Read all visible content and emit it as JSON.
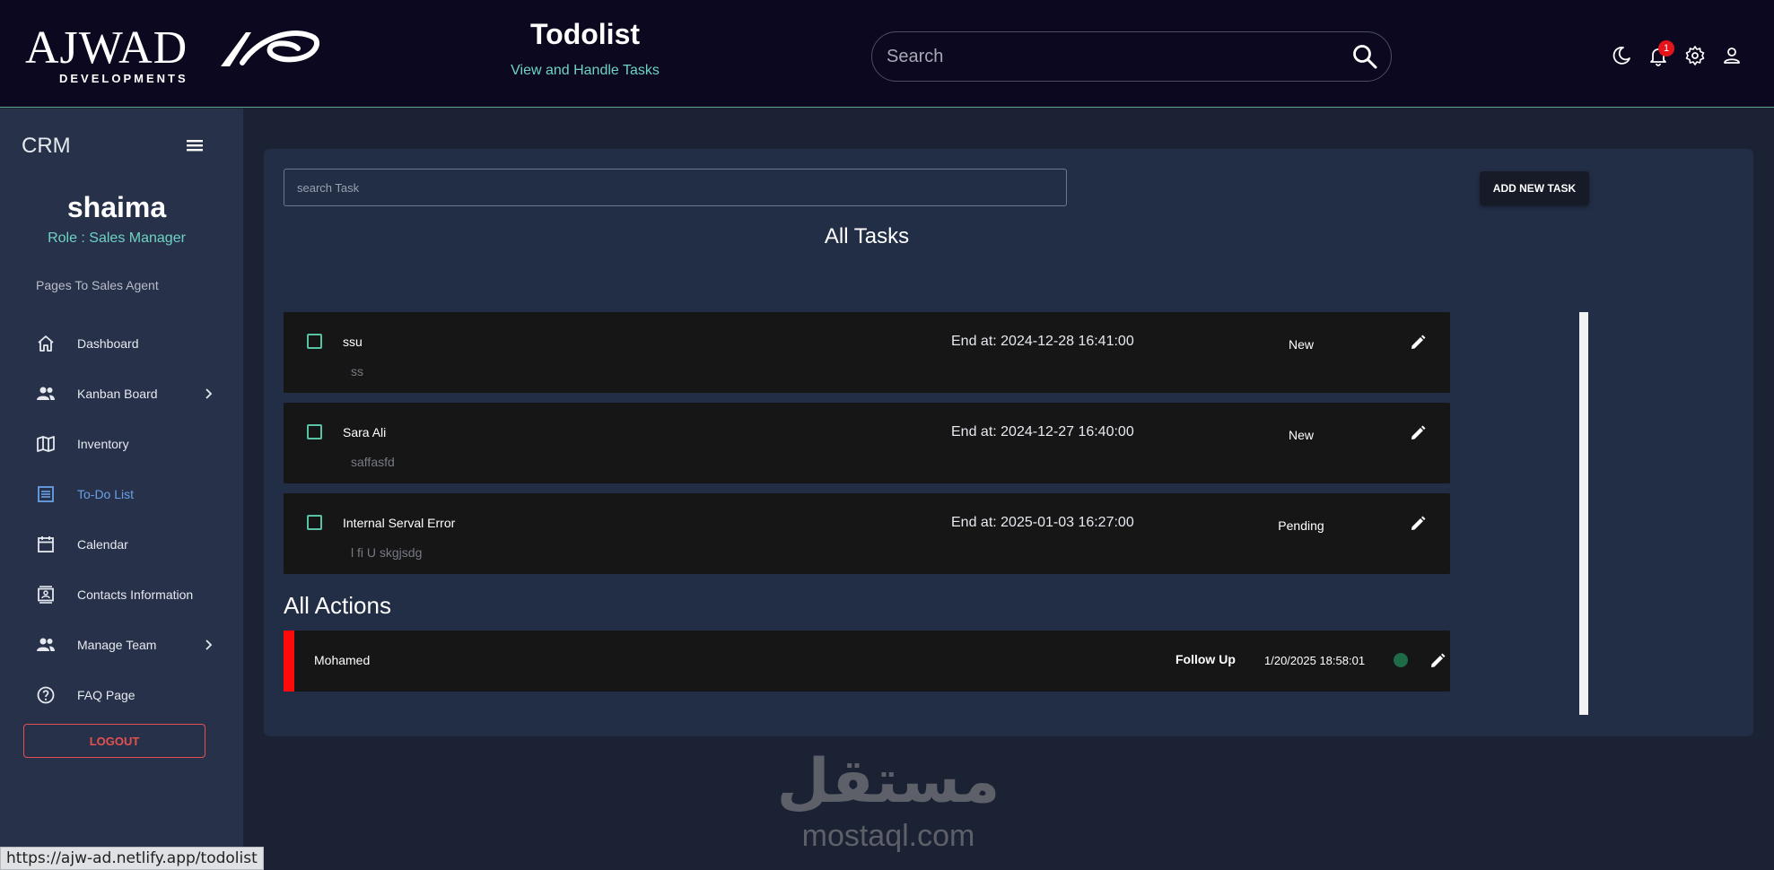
{
  "header": {
    "logo_main": "AJWAD",
    "logo_sub": "DEVELOPMENTS",
    "title": "Todolist",
    "subtitle": "View and Handle Tasks",
    "search_placeholder": "Search",
    "notification_count": "1",
    "icons": [
      "moon-icon",
      "bell-icon",
      "gear-icon",
      "user-icon"
    ]
  },
  "sidebar": {
    "brand": "CRM",
    "user_name": "shaima",
    "user_role": "Role : Sales Manager",
    "section_label": "Pages To Sales Agent",
    "items": [
      {
        "label": "Dashboard",
        "icon": "home-icon"
      },
      {
        "label": "Kanban Board",
        "icon": "people-icon",
        "has_submenu": true
      },
      {
        "label": "Inventory",
        "icon": "map-icon"
      },
      {
        "label": "To-Do List",
        "icon": "list-icon",
        "active": true
      },
      {
        "label": "Calendar",
        "icon": "calendar-icon"
      },
      {
        "label": "Contacts Information",
        "icon": "contacts-icon"
      },
      {
        "label": "Manage Team",
        "icon": "people-icon",
        "has_submenu": true
      },
      {
        "label": "FAQ Page",
        "icon": "help-icon"
      }
    ],
    "logout_label": "LOGOUT"
  },
  "main": {
    "search_placeholder": "search Task",
    "add_task_label": "ADD NEW TASK",
    "tasks_heading": "All Tasks",
    "tasks": [
      {
        "title": "ssu",
        "description": "ss",
        "end_at": "End at: 2024-12-28  16:41:00",
        "status": "New"
      },
      {
        "title": "Sara Ali",
        "description": "saffasfd",
        "end_at": "End at: 2024-12-27  16:40:00",
        "status": "New"
      },
      {
        "title": "Internal Serval Error",
        "description": "l fi U skgjsdg",
        "end_at": "End at: 2025-01-03  16:27:00",
        "status": "Pending"
      }
    ],
    "actions_heading": "All Actions",
    "actions": [
      {
        "name": "Mohamed",
        "type": "Follow Up",
        "date": "1/20/2025 18:58:01"
      }
    ]
  },
  "watermark": {
    "arabic": "مستقل",
    "latin": "mostaql.com"
  },
  "status_url": "https://ajw-ad.netlify.app/todolist",
  "colors": {
    "header_bg": "#0b0820",
    "sidebar_bg": "#27314a",
    "card_bg": "#222d46",
    "accent_teal": "#6fd3c3",
    "active_nav": "#6aa1e6",
    "logout_red": "#e3524f",
    "priority_red": "#ff0a0a",
    "status_dot_green": "#1f6b47"
  }
}
